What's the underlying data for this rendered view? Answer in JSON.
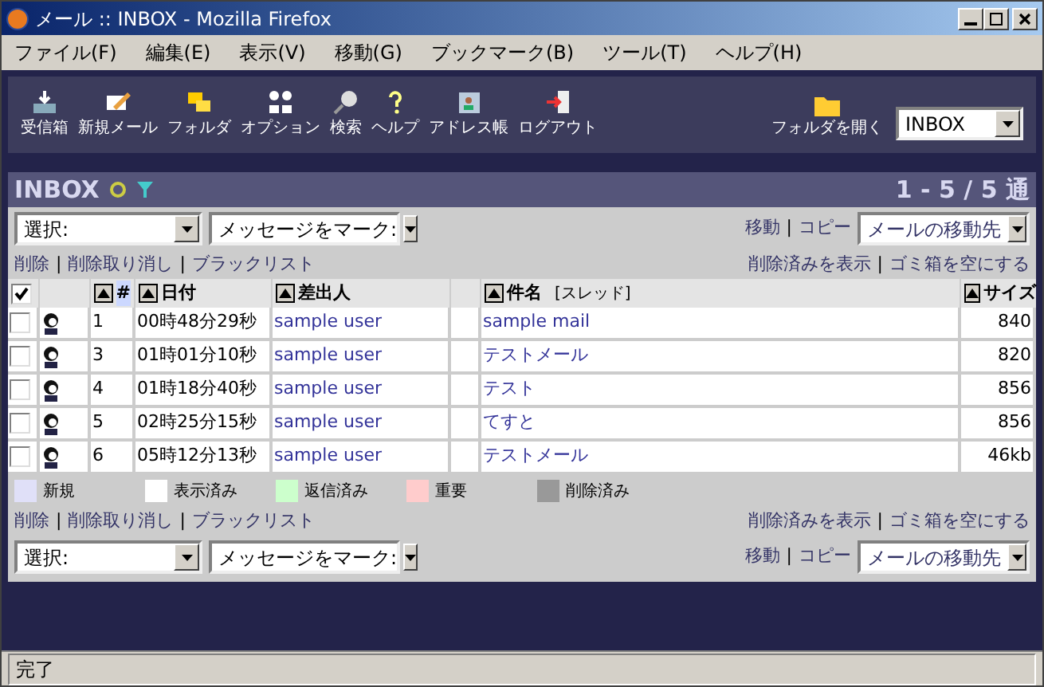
{
  "window": {
    "title": "メール :: INBOX - Mozilla Firefox"
  },
  "menu": [
    "ファイル(F)",
    "編集(E)",
    "表示(V)",
    "移動(G)",
    "ブックマーク(B)",
    "ツール(T)",
    "ヘルプ(H)"
  ],
  "toolbar": [
    {
      "kind": "inbox",
      "label": "受信箱"
    },
    {
      "kind": "compose",
      "label": "新規メール"
    },
    {
      "kind": "folders",
      "label": "フォルダ"
    },
    {
      "kind": "options",
      "label": "オプション"
    },
    {
      "kind": "search",
      "label": "検索"
    },
    {
      "kind": "help",
      "label": "ヘルプ"
    },
    {
      "kind": "addressbook",
      "label": "アドレス帳"
    },
    {
      "kind": "logout",
      "label": "ログアウト"
    }
  ],
  "open_folder": {
    "label": "フォルダを開く",
    "value": "INBOX"
  },
  "mailbox": {
    "title": "INBOX",
    "count": "1 - 5 / 5 通"
  },
  "top_controls": {
    "select": "選択:",
    "mark": "メッセージをマーク:",
    "move": "移動",
    "separator": "|",
    "copy": "コピー",
    "target": "メールの移動先"
  },
  "top_links": {
    "separator": "|",
    "left": [
      "削除",
      "削除取り消し",
      "ブラックリスト"
    ],
    "right": [
      "削除済みを表示",
      "ゴミ箱を空にする"
    ]
  },
  "table": {
    "select_all": {
      "checked": true
    },
    "columns": {
      "number": "#",
      "date": "日付",
      "from": "差出人",
      "subject": "件名",
      "thread": "[スレッド]",
      "size": "サイズ"
    },
    "rows": [
      {
        "checked": false,
        "number": "1",
        "date": "00時48分29秒",
        "from": "sample user",
        "subject": "sample mail",
        "size": "840"
      },
      {
        "checked": false,
        "number": "3",
        "date": "01時01分10秒",
        "from": "sample user",
        "subject": "テストメール",
        "size": "820"
      },
      {
        "checked": false,
        "number": "4",
        "date": "01時18分40秒",
        "from": "sample user",
        "subject": "テスト",
        "size": "856"
      },
      {
        "checked": false,
        "number": "5",
        "date": "02時25分15秒",
        "from": "sample user",
        "subject": "てすと",
        "size": "856"
      },
      {
        "checked": false,
        "number": "6",
        "date": "05時12分13秒",
        "from": "sample user",
        "subject": "テストメール",
        "size": "46kb"
      }
    ]
  },
  "legend": [
    {
      "label": "新規",
      "color": "#e0e0f8"
    },
    {
      "label": "表示済み",
      "color": "#ffffff"
    },
    {
      "label": "返信済み",
      "color": "#ccffcc"
    },
    {
      "label": "重要",
      "color": "#ffcccc"
    },
    {
      "label": "削除済み",
      "color": "#999999"
    }
  ],
  "bottom_links": {
    "separator": "|",
    "left": [
      "削除",
      "削除取り消し",
      "ブラックリスト"
    ],
    "right": [
      "削除済みを表示",
      "ゴミ箱を空にする"
    ]
  },
  "bottom_controls": {
    "select": "選択:",
    "mark": "メッセージをマーク:",
    "move": "移動",
    "separator": "|",
    "copy": "コピー",
    "target": "メールの移動先"
  },
  "status_bar": "完了"
}
